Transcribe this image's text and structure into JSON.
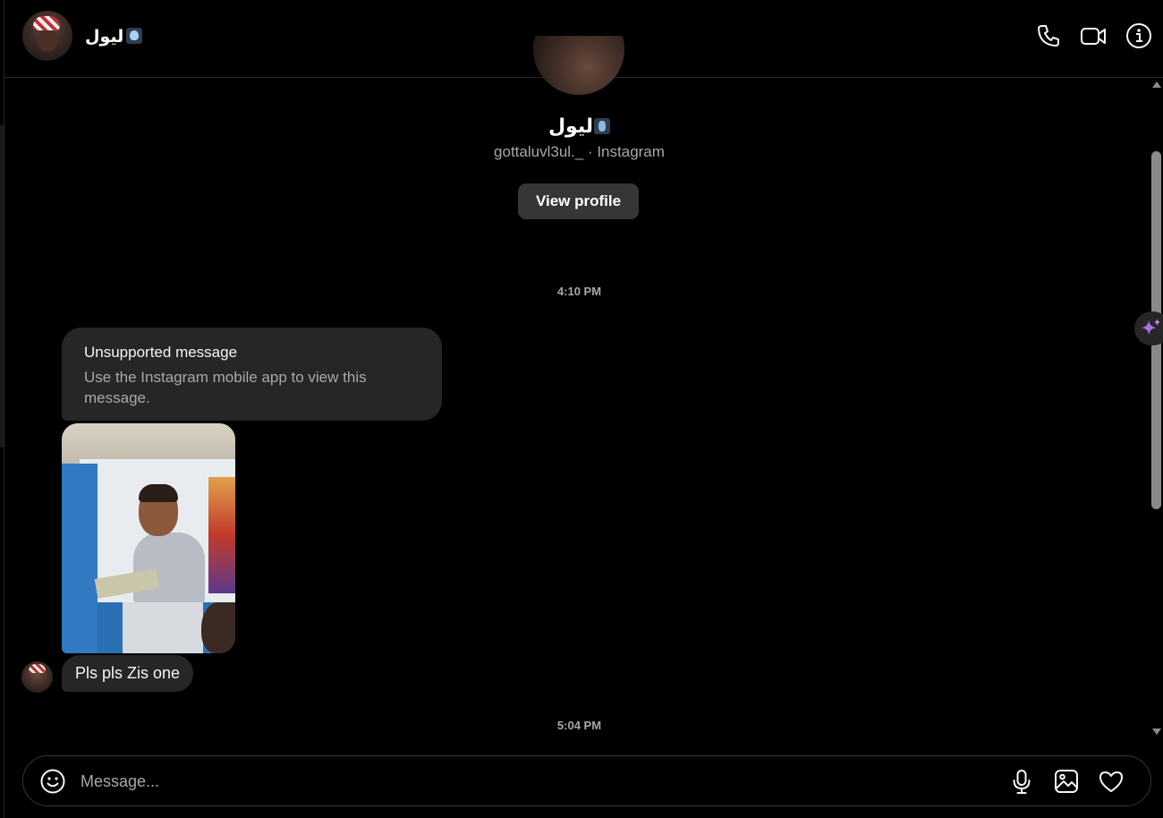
{
  "header": {
    "name": "ليول",
    "icons": [
      "phone-icon",
      "video-call-icon",
      "info-icon"
    ]
  },
  "profile": {
    "name": "ليول",
    "subtitle": "gottaluvl3ul._ · Instagram",
    "view_profile_label": "View profile"
  },
  "timestamps": [
    "4:10 PM",
    "5:04 PM"
  ],
  "messages": {
    "unsupported_title": "Unsupported message",
    "unsupported_body": "Use the Instagram mobile app to view this message.",
    "text_message": "Pls pls Zis one"
  },
  "composer": {
    "placeholder": "Message...",
    "icons": [
      "emoji-icon",
      "microphone-icon",
      "image-icon",
      "heart-icon"
    ]
  }
}
